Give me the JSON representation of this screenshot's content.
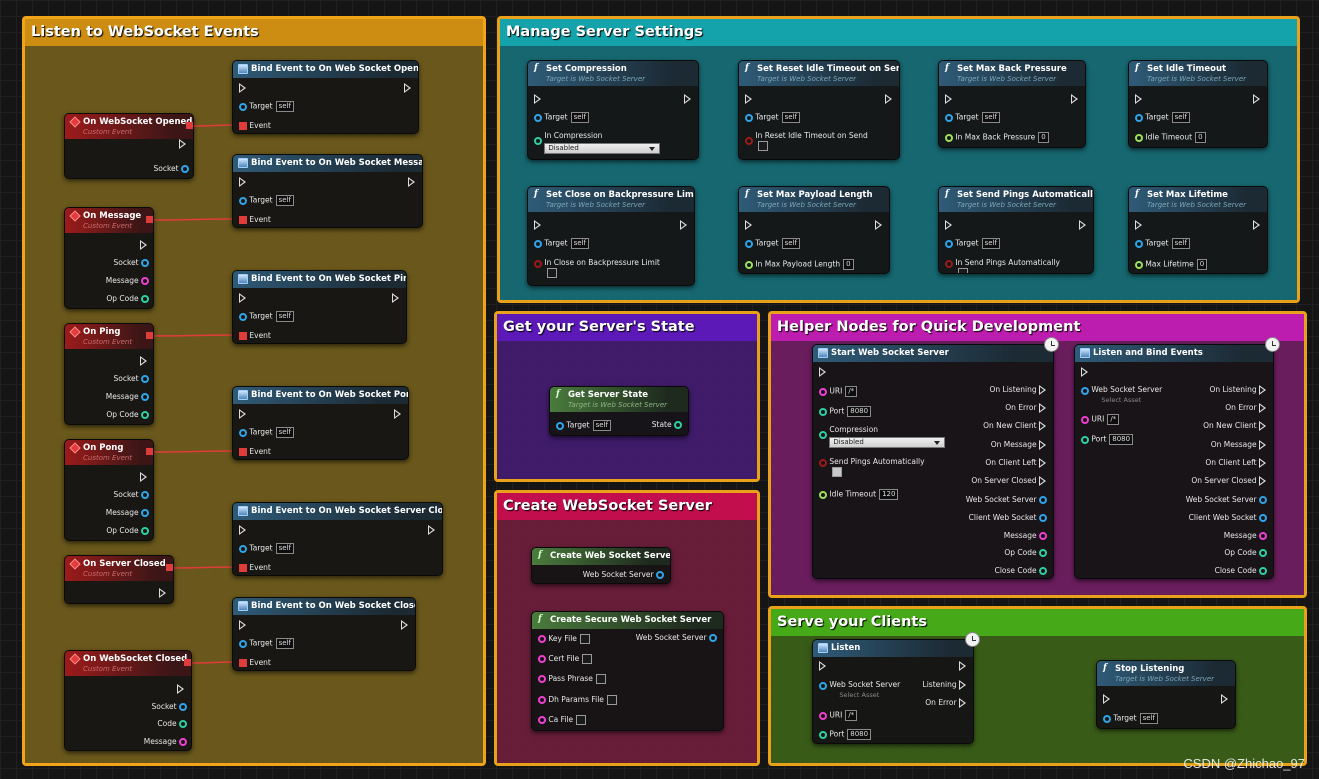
{
  "watermark": "CSDN @Zhichao_97",
  "comments": {
    "listen": "Listen to WebSocket Events",
    "manage": "Manage Server Settings",
    "state": "Get your Server's State",
    "helper": "Helper Nodes for Quick Development",
    "create": "Create WebSocket Server",
    "serve": "Serve your Clients"
  },
  "pins": {
    "target": "Target",
    "self": "self",
    "event": "Event",
    "socket": "Socket",
    "message": "Message",
    "op_code": "Op Code",
    "code": "Code",
    "state": "State",
    "web_socket_server": "Web Socket Server",
    "uri": "URI",
    "uri_val": "/*",
    "port": "Port",
    "port_val": "8080",
    "compression": "Compression",
    "disabled": "Disabled",
    "send_pings": "Send Pings Automatically",
    "idle_timeout": "Idle Timeout",
    "idle_val": "120",
    "select_asset": "Select Asset",
    "zero": "0",
    "listening": "Listening",
    "on_error": "On Error",
    "key_file": "Key File",
    "cert_file": "Cert File",
    "pass_phrase": "Pass Phrase",
    "dh_params": "Dh Params File",
    "ca_file": "Ca File",
    "on_listening": "On Listening",
    "on_new_client": "On New Client",
    "on_message": "On Message",
    "on_client_left": "On Client Left",
    "on_server_closed": "On Server Closed",
    "client_web_socket": "Client Web Socket",
    "in_compression": "In Compression",
    "in_reset": "In Reset Idle Timeout on Send",
    "in_max_bp": "In Max Back Pressure",
    "in_close_bp": "In Close on Backpressure Limit",
    "in_max_payload": "In Max Payload Length",
    "in_send_pings": "In Send Pings Automatically",
    "max_lifetime": "Max Lifetime"
  },
  "events": {
    "opened": "On WebSocket Opened",
    "message": "On Message",
    "ping": "On Ping",
    "pong": "On Pong",
    "server_closed": "On Server Closed",
    "closed": "On WebSocket Closed",
    "custom": "Custom Event"
  },
  "binds": {
    "opened": "Bind Event to On Web Socket Opened",
    "message": "Bind Event to On Web Socket Message",
    "ping": "Bind Event to On Web Socket Ping",
    "pong": "Bind Event to On Web Socket Pong",
    "server_closed": "Bind Event to On Web Socket Server Closed",
    "closed": "Bind Event to On Web Socket Closed"
  },
  "setters": {
    "compression": "Set Compression",
    "reset": "Set Reset Idle Timeout on Send",
    "back_pressure": "Set Max Back Pressure",
    "idle": "Set Idle Timeout",
    "close_bp": "Set Close on Backpressure Limit",
    "payload": "Set Max Payload Length",
    "pings": "Set Send Pings Automatically",
    "lifetime": "Set Max Lifetime",
    "sub": "Target is Web Socket Server"
  },
  "nodes": {
    "get_state": "Get Server State",
    "start": "Start Web Socket Server",
    "listen_bind": "Listen and Bind Events",
    "create": "Create Web Socket Server",
    "create_secure": "Create Secure Web Socket Server",
    "listen": "Listen",
    "stop": "Stop Listening"
  }
}
